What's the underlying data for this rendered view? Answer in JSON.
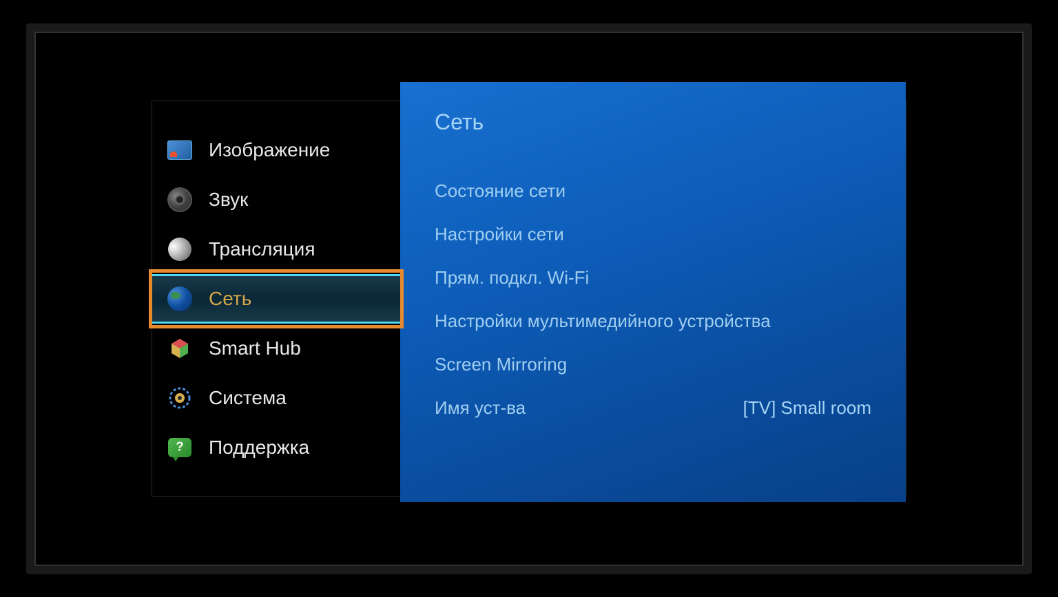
{
  "sidebar": {
    "items": [
      {
        "label": "Изображение",
        "icon": "picture"
      },
      {
        "label": "Звук",
        "icon": "sound"
      },
      {
        "label": "Трансляция",
        "icon": "broadcast"
      },
      {
        "label": "Сеть",
        "icon": "network",
        "selected": true,
        "highlighted": true
      },
      {
        "label": "Smart Hub",
        "icon": "smarthub"
      },
      {
        "label": "Система",
        "icon": "system"
      },
      {
        "label": "Поддержка",
        "icon": "support"
      }
    ]
  },
  "panel": {
    "title": "Сеть",
    "items": [
      {
        "label": "Состояние сети"
      },
      {
        "label": "Настройки сети"
      },
      {
        "label": "Прям. подкл. Wi-Fi"
      },
      {
        "label": "Настройки мультимедийного устройства"
      },
      {
        "label": "Screen Mirroring"
      },
      {
        "label": "Имя уст-ва",
        "value": "[TV] Small room"
      }
    ]
  }
}
